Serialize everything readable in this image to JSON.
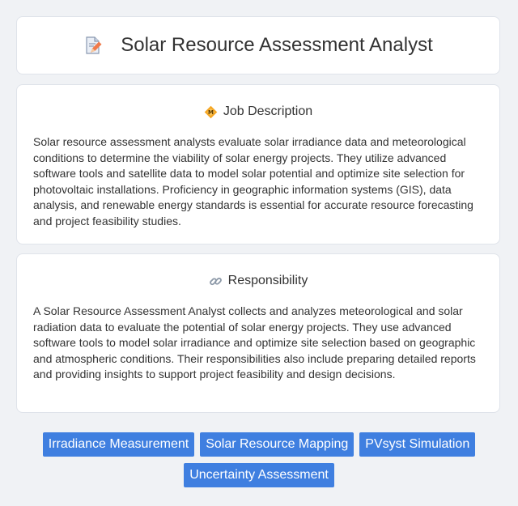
{
  "header": {
    "title": "Solar Resource Assessment Analyst",
    "icon": "document-pencil-icon"
  },
  "job_description": {
    "icon": "diamond-badge-icon",
    "heading": "Job Description",
    "body": "Solar resource assessment analysts evaluate solar irradiance data and meteorological conditions to determine the viability of solar energy projects. They utilize advanced software tools and satellite data to model solar potential and optimize site selection for photovoltaic installations. Proficiency in geographic information systems (GIS), data analysis, and renewable energy standards is essential for accurate resource forecasting and project feasibility studies."
  },
  "responsibility": {
    "icon": "link-icon",
    "heading": "Responsibility",
    "body": "A Solar Resource Assessment Analyst collects and analyzes meteorological and solar radiation data to evaluate the potential of solar energy projects. They use advanced software tools to model solar irradiance and optimize site selection based on geographic and atmospheric conditions. Their responsibilities also include preparing detailed reports and providing insights to support project feasibility and design decisions."
  },
  "tags": [
    "Irradiance Measurement",
    "Solar Resource Mapping",
    "PVsyst Simulation",
    "Uncertainty Assessment"
  ],
  "colors": {
    "background": "#f0f2f5",
    "card": "#ffffff",
    "tag": "#3f7fe0",
    "tag_text": "#ffffff"
  }
}
